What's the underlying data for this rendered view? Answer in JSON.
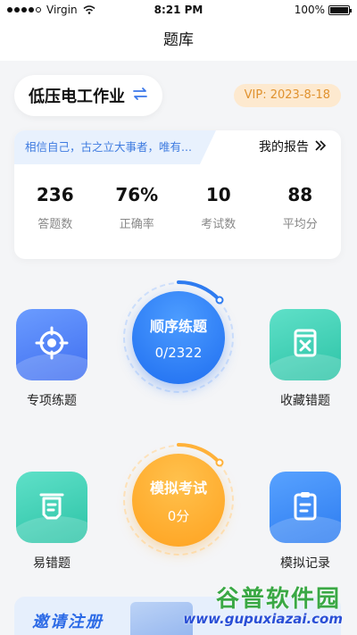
{
  "status_bar": {
    "carrier": "Virgin",
    "time": "8:21 PM",
    "battery": "100%"
  },
  "nav": {
    "title": "题库"
  },
  "subject": {
    "name": "低压电工作业",
    "icon": "swap-icon"
  },
  "vip": {
    "label": "VIP: 2023-8-18"
  },
  "card": {
    "motto": "相信自己，古之立大事者，唯有...",
    "report_label": "我的报告",
    "report_icon": "double-chevron-right-icon",
    "stats": [
      {
        "value": "236",
        "label": "答题数"
      },
      {
        "value": "76%",
        "label": "正确率"
      },
      {
        "value": "10",
        "label": "考试数"
      },
      {
        "value": "88",
        "label": "平均分"
      }
    ]
  },
  "features": {
    "special": {
      "label": "专项练题",
      "icon": "target-icon"
    },
    "favorites": {
      "label": "收藏错题",
      "icon": "bookmark-x-icon"
    },
    "mistakes": {
      "label": "易错题",
      "icon": "document-stack-icon"
    },
    "records": {
      "label": "模拟记录",
      "icon": "clipboard-icon"
    }
  },
  "sequence": {
    "title": "顺序练题",
    "progress": "0/2322"
  },
  "mock": {
    "title": "模拟考试",
    "score": "0分"
  },
  "invite": {
    "text": "邀请注册"
  },
  "watermark": {
    "title": "谷普软件园",
    "url": "www.gupuxiazai.com"
  },
  "colors": {
    "accent_blue": "#1f6ef0",
    "accent_orange": "#ffa21f",
    "vip_bg": "#fde9cf",
    "vip_text": "#e0922f"
  }
}
